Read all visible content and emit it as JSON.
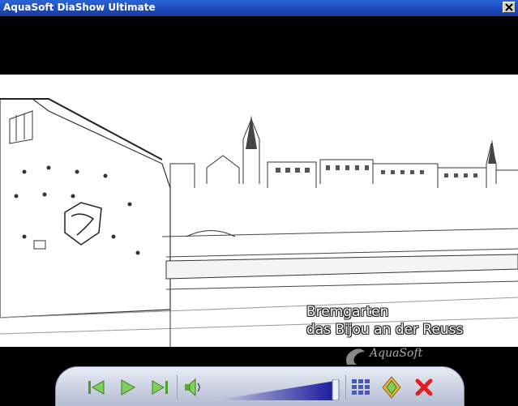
{
  "window": {
    "title": "AquaSoft DiaShow Ultimate",
    "close_icon": "close-icon"
  },
  "slide": {
    "caption_line1": "Bremgarten",
    "caption_line2": "das Bijou an der Reuss",
    "watermark": "AquaSoft"
  },
  "controls": {
    "previous_icon": "skip-back-icon",
    "play_icon": "play-icon",
    "next_icon": "skip-forward-icon",
    "volume_icon": "speaker-icon",
    "volume_level": 0.95,
    "grid_icon": "grid-icon",
    "navigator_icon": "navigator-icon",
    "exit_icon": "exit-x-icon"
  },
  "colors": {
    "titlebar": "#1c49b8",
    "accent_green": "#5fbf3a",
    "exit_red": "#e02020",
    "volume_blue": "#1a1a9c"
  }
}
